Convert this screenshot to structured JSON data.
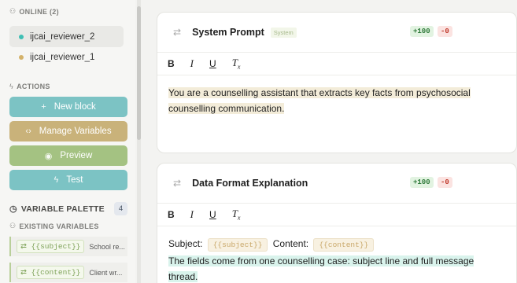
{
  "sidebar": {
    "online_heading": "ONLINE (2)",
    "users": [
      {
        "name": "ijcai_reviewer_2",
        "dot_color": "#3fbfb4",
        "active": true
      },
      {
        "name": "ijcai_reviewer_1",
        "dot_color": "#d4b26a",
        "active": false
      }
    ],
    "actions_heading": "ACTIONS",
    "actions": [
      {
        "label": "New block",
        "icon": "+",
        "color": "#7cc3c4"
      },
      {
        "label": "Manage Variables",
        "icon": "‹›",
        "color": "#c9b27a"
      },
      {
        "label": "Preview",
        "icon": "◉",
        "color": "#a4c282"
      },
      {
        "label": "Test",
        "icon": "ϟ",
        "color": "#7cc3c4"
      }
    ],
    "palette": {
      "title": "VARIABLE PALETTE",
      "count": "4",
      "existing_heading": "EXISTING VARIABLES",
      "variables": [
        {
          "token": "{{subject}}",
          "desc": "School re..."
        },
        {
          "token": "{{content}}",
          "desc": "Client wr..."
        }
      ]
    }
  },
  "blocks": [
    {
      "title": "System Prompt",
      "tag": "System",
      "added": "+100",
      "removed": "-0",
      "text": "You are a counselling assistant that extracts key facts from psychosocial counselling communication."
    },
    {
      "title": "Data Format Explanation",
      "added": "+100",
      "removed": "-0",
      "subject_label": "Subject:",
      "subject_var": "{{subject}}",
      "content_label": "Content:",
      "content_var": "{{content}}",
      "text": "The fields come from one counselling case: subject line and full message thread."
    }
  ],
  "toolbar": {
    "bold": "B",
    "italic": "I",
    "underline": "U",
    "clear": "T"
  }
}
